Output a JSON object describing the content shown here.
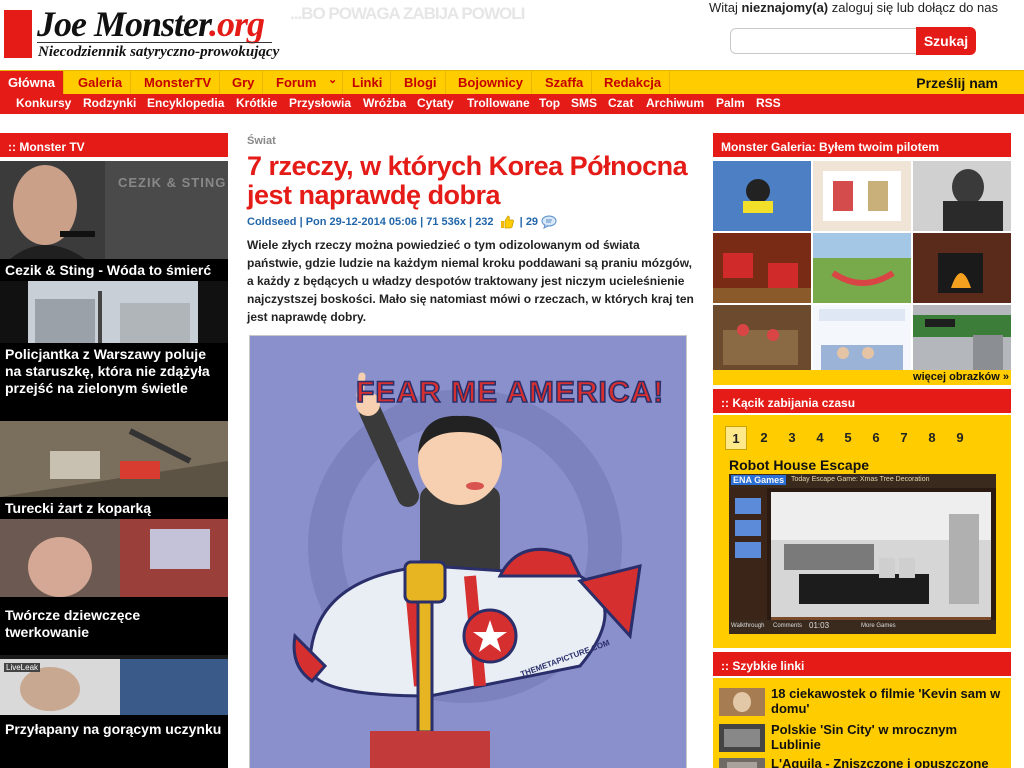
{
  "header": {
    "logo_main": "Joe Monster",
    "logo_tld": ".org",
    "tagline": "Niecodziennik satyryczno-prowokujący",
    "motto": "...BO POWAGA ZABIJA POWOLI",
    "welcome_prefix": "Witaj",
    "welcome_user": "nieznajomy(a)",
    "welcome_suffix": "zaloguj się lub dołącz do nas",
    "search_value": "",
    "search_button": "Szukaj"
  },
  "nav": {
    "main": [
      "Główna",
      "Galeria",
      "MonsterTV",
      "Gry",
      "Forum",
      "Linki",
      "Blogi",
      "Bojownicy",
      "Szaffa",
      "Redakcja"
    ],
    "forum_arrow": "⌄",
    "send": "Prześlij nam",
    "sub": [
      "Konkursy",
      "Rodzynki",
      "Encyklopedia",
      "Krótkie",
      "Przysłowia",
      "Wróżba",
      "Cytaty",
      "Trollowane",
      "Top",
      "SMS",
      "Czat",
      "Archiwum",
      "Palm",
      "RSS"
    ]
  },
  "left": {
    "heading": ":: Monster TV",
    "items": [
      {
        "caption": "Cezik & Sting - Wóda to śmierć",
        "overlay": "CEZIK & STING"
      },
      {
        "caption": "Policjantka z Warszawy poluje na staruszkę, która nie zdążyła przejść na zielonym świetle"
      },
      {
        "caption": "Turecki żart z koparką"
      },
      {
        "caption": "Twórcze dziewczęce twerkowanie"
      },
      {
        "caption": "Przyłapany na gorącym uczynku",
        "overlay": "LiveLeak"
      }
    ]
  },
  "article": {
    "category": "Świat",
    "title": "7 rzeczy, w których Korea Północna jest naprawdę dobra",
    "author": "Coldseed",
    "date": "Pon 29-12-2014 05:06",
    "views": "71 536x",
    "likes": "232",
    "comments": "29",
    "lead": "Wiele złych rzeczy można powiedzieć o tym odizolowanym od świata państwie, gdzie ludzie na każdym niemal kroku poddawani są praniu mózgów, a każdy z będących u władzy despotów traktowany jest niczym ucieleśnienie najczystszej boskości. Mało się natomiast mówi o rzeczach, w których kraj ten jest naprawdę dobry.",
    "image_text": "FEAR ME AMERICA!",
    "image_watermark": "THEMETAPICTURE.COM"
  },
  "right": {
    "gallery_heading": "Monster Galeria: Byłem twoim pilotem",
    "more_images": "więcej obrazków »",
    "games_heading": ":: Kącik zabijania czasu",
    "pages": [
      "1",
      "2",
      "3",
      "4",
      "5",
      "6",
      "7",
      "8",
      "9"
    ],
    "game_title": "Robot House Escape",
    "game_brand": "ENA Games",
    "game_caption": "Today Escape Game: Xmas Tree Decoration",
    "game_timer": "01:03",
    "game_walkthrough": "Walkthrough",
    "game_more": "More Games",
    "game_comments": "Comments",
    "links_heading": ":: Szybkie linki",
    "links": [
      "18 ciekawostek o filmie 'Kevin sam w domu'",
      "Polskie 'Sin City' w mrocznym Lublinie",
      "L'Aquila - Zniszczone i opuszczone"
    ]
  }
}
